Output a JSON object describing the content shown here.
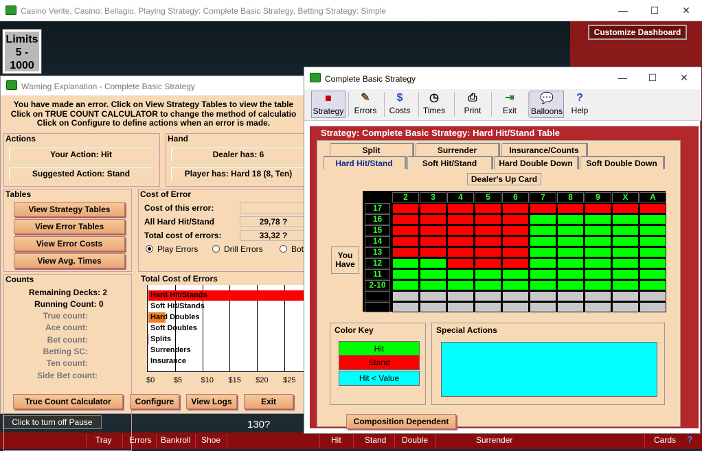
{
  "main_window": {
    "title": "Casino Verite, Casino: Bellagio, Playing Strategy: Complete Basic Strategy, Betting Strategy: Simple",
    "minimize": "—",
    "maximize": "☐",
    "close": "✕"
  },
  "limits": {
    "line1": "Limits",
    "line2": "5 -",
    "line3": "1000"
  },
  "customize_dashboard": "Customize Dashboard",
  "pause_button": "Click to turn off Pause",
  "count_display": "130?",
  "bottom_bar": [
    "Tray",
    "Errors",
    "Bankroll",
    "Shoe",
    "Hit",
    "Stand",
    "Double",
    "Surrender",
    "Cards"
  ],
  "warning": {
    "title": "Warning Explanation - Complete Basic Strategy",
    "message": [
      "You have made an error. Click on View Strategy Tables to view the table",
      "Click on TRUE COUNT CALCULATOR to change the method of calculatio",
      "Click on Configure to define actions when an error is made."
    ],
    "actions": {
      "heading": "Actions",
      "your_action": "Your Action: Hit",
      "suggested": "Suggested Action: Stand"
    },
    "hand": {
      "heading": "Hand",
      "dealer": "Dealer has: 6",
      "player": "Player has: Hard 18 (8, Ten)"
    },
    "tables": {
      "heading": "Tables",
      "buttons": [
        "View Strategy Tables",
        "View Error Tables",
        "View Error Costs",
        "View Avg. Times"
      ]
    },
    "cost": {
      "heading": "Cost of Error",
      "this_error_label": "Cost of this error:",
      "this_error_value": "",
      "hard_label": "All Hard Hit/Stand",
      "hard_value": "29,78 ?",
      "total_label": "Total cost of errors:",
      "total_value": "33,32 ?",
      "radios": [
        "Play Errors",
        "Drill Errors",
        "Bot"
      ]
    },
    "counts": {
      "heading": "Counts",
      "items": [
        {
          "label": "Remaining Decks: 2",
          "active": true
        },
        {
          "label": "Running Count: 0",
          "active": true
        },
        {
          "label": "True count:",
          "active": false
        },
        {
          "label": "Ace count:",
          "active": false
        },
        {
          "label": "Bet count:",
          "active": false
        },
        {
          "label": "Betting SC:",
          "active": false
        },
        {
          "label": "Ten count:",
          "active": false
        },
        {
          "label": "Side Bet count:",
          "active": false
        }
      ]
    },
    "total_cost_heading": "Total Cost of Errors",
    "bottom_buttons": [
      "True Count Calculator",
      "Configure",
      "View Logs",
      "Exit"
    ]
  },
  "chart_data": {
    "type": "bar",
    "orientation": "horizontal",
    "title": "Total Cost of Errors",
    "categories": [
      "Hard Hit/Stands",
      "Soft Hit/Stands",
      "Hard Doubles",
      "Soft Doubles",
      "Splits",
      "Surrenders",
      "Insurance"
    ],
    "values": [
      29.78,
      0,
      3.2,
      0,
      0.1,
      0,
      0
    ],
    "colors": [
      "#ff0000",
      "#cccccc",
      "#f08020",
      "#cccccc",
      "#ff66ff",
      "#cccccc",
      "#cccccc"
    ],
    "x_ticks": [
      "$0",
      "$5",
      "$10",
      "$15",
      "$20",
      "$25"
    ],
    "xlim": [
      0,
      29
    ]
  },
  "strategy": {
    "title": "Complete Basic Strategy",
    "toolbar": [
      {
        "icon": "■",
        "label": "Strategy"
      },
      {
        "icon": "✎",
        "label": "Errors"
      },
      {
        "icon": "$",
        "label": "Costs"
      },
      {
        "icon": "◷",
        "label": "Times"
      },
      {
        "icon": "⎙",
        "label": "Print"
      },
      {
        "icon": "⇥",
        "label": "Exit"
      },
      {
        "icon": "💬",
        "label": "Balloons"
      },
      {
        "icon": "?",
        "label": "Help"
      }
    ],
    "header": "Strategy: Complete Basic Strategy: Hard Hit/Stand Table",
    "tabs_row1": [
      "Split",
      "Surrender",
      "Insurance/Counts"
    ],
    "tabs_row2": [
      "Hard Hit/Stand",
      "Soft Hit/Stand",
      "Hard Double Down",
      "Soft Double Down"
    ],
    "dealer_up": "Dealer's Up Card",
    "you_have": [
      "You",
      "Have"
    ],
    "columns": [
      "2",
      "3",
      "4",
      "5",
      "6",
      "7",
      "8",
      "9",
      "X",
      "A"
    ],
    "rows": [
      {
        "label": "17",
        "cells": "SSSSSSSSSS"
      },
      {
        "label": "16",
        "cells": "SSSSSHHHHH"
      },
      {
        "label": "15",
        "cells": "SSSSSHHHHH"
      },
      {
        "label": "14",
        "cells": "SSSSSHHHHH"
      },
      {
        "label": "13",
        "cells": "SSSSSHHHHH"
      },
      {
        "label": "12",
        "cells": "HHSSSHHHHH"
      },
      {
        "label": "11",
        "cells": "HHHHHHHHHH"
      },
      {
        "label": "2-10",
        "cells": "HHHHHHHHHH"
      },
      {
        "label": "",
        "cells": "GGGGGGGGGG"
      },
      {
        "label": "",
        "cells": "GGGGGGGGGG"
      }
    ],
    "color_key": {
      "heading": "Color Key",
      "items": [
        {
          "label": "Hit",
          "color": "#00ff00"
        },
        {
          "label": "Stand",
          "color": "#ff0000"
        },
        {
          "label": "Hit < Value",
          "color": "#00ffff"
        }
      ]
    },
    "special_heading": "Special Actions",
    "composition_btn": "Composition Dependent"
  },
  "colors": {
    "hit": "#00ff00",
    "stand": "#ff0000",
    "blank": "#c8c8c8"
  }
}
